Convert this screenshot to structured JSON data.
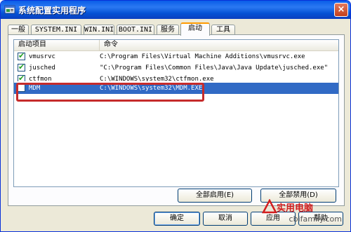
{
  "window": {
    "title": "系统配置实用程序",
    "close_symbol": "×"
  },
  "tabs": [
    {
      "label": "一般"
    },
    {
      "label": "SYSTEM.INI"
    },
    {
      "label": "WIN.INI"
    },
    {
      "label": "BOOT.INI"
    },
    {
      "label": "服务"
    },
    {
      "label": "启动",
      "selected": true
    },
    {
      "label": "工具"
    }
  ],
  "list": {
    "columns": [
      "启动项目",
      "命令"
    ],
    "rows": [
      {
        "name": "vmusrvc",
        "command": "C:\\Program Files\\Virtual Machine Additions\\vmusrvc.exe",
        "checked": true,
        "selected": false
      },
      {
        "name": "jusched",
        "command": "\"C:\\Program Files\\Common Files\\Java\\Java Update\\jusched.exe\"",
        "checked": true,
        "selected": false
      },
      {
        "name": "ctfmon",
        "command": "C:\\WINDOWS\\system32\\ctfmon.exe",
        "checked": true,
        "selected": false
      },
      {
        "name": "MDM",
        "command": "C:\\WINDOWS\\system32\\MDM.EXE",
        "checked": false,
        "selected": true
      }
    ]
  },
  "buttons": {
    "enable_all": "全部启用(E)",
    "disable_all": "全部禁用(D)",
    "ok": "确定",
    "cancel": "取消",
    "apply": "应用",
    "help": "帮助"
  },
  "watermark": {
    "logo": "实用电脑",
    "url": "cbifamily.com"
  },
  "colors": {
    "titlebar": "#0a5ee8",
    "selection": "#316ac5",
    "highlight_box": "#c62b2b",
    "watermark": "#d21e1e"
  }
}
